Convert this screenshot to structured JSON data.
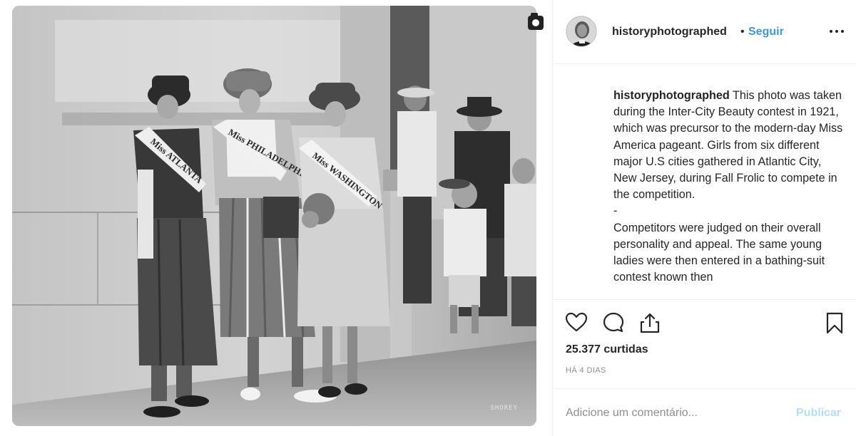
{
  "post": {
    "username": "historyphotographed",
    "separator": "•",
    "follow_label": "Seguir",
    "more_icon": "more-options-icon",
    "photo_credit": "SHOREY"
  },
  "caption": {
    "username": "historyphotographed",
    "text": " This photo was taken during the Inter-City Beauty contest in 1921, which was precursor to the modern-day Miss America pageant. Girls from six different major U.S cities gathered in Atlantic City, New Jersey, during Fall Frolic to compete in the competition.\n-\nCompetitors were judged on their overall personality and appeal. The same young ladies were then entered in a bathing-suit contest known then"
  },
  "sashes": {
    "left": "Miss ATLANTA",
    "middle": "Miss PHILADELPHIA",
    "right": "Miss WASHINGTON"
  },
  "actions": {
    "like_icon": "heart-icon",
    "comment_icon": "comment-icon",
    "share_icon": "share-icon",
    "save_icon": "bookmark-icon"
  },
  "stats": {
    "likes": "25.377 curtidas",
    "time_ago": "HÁ 4 DIAS"
  },
  "comment": {
    "placeholder": "Adicione um comentário...",
    "publish_label": "Publicar"
  },
  "colors": {
    "link": "#3897f0",
    "publish_disabled": "#b2dffc",
    "muted": "#8e8e8e",
    "divider": "#efefef"
  }
}
